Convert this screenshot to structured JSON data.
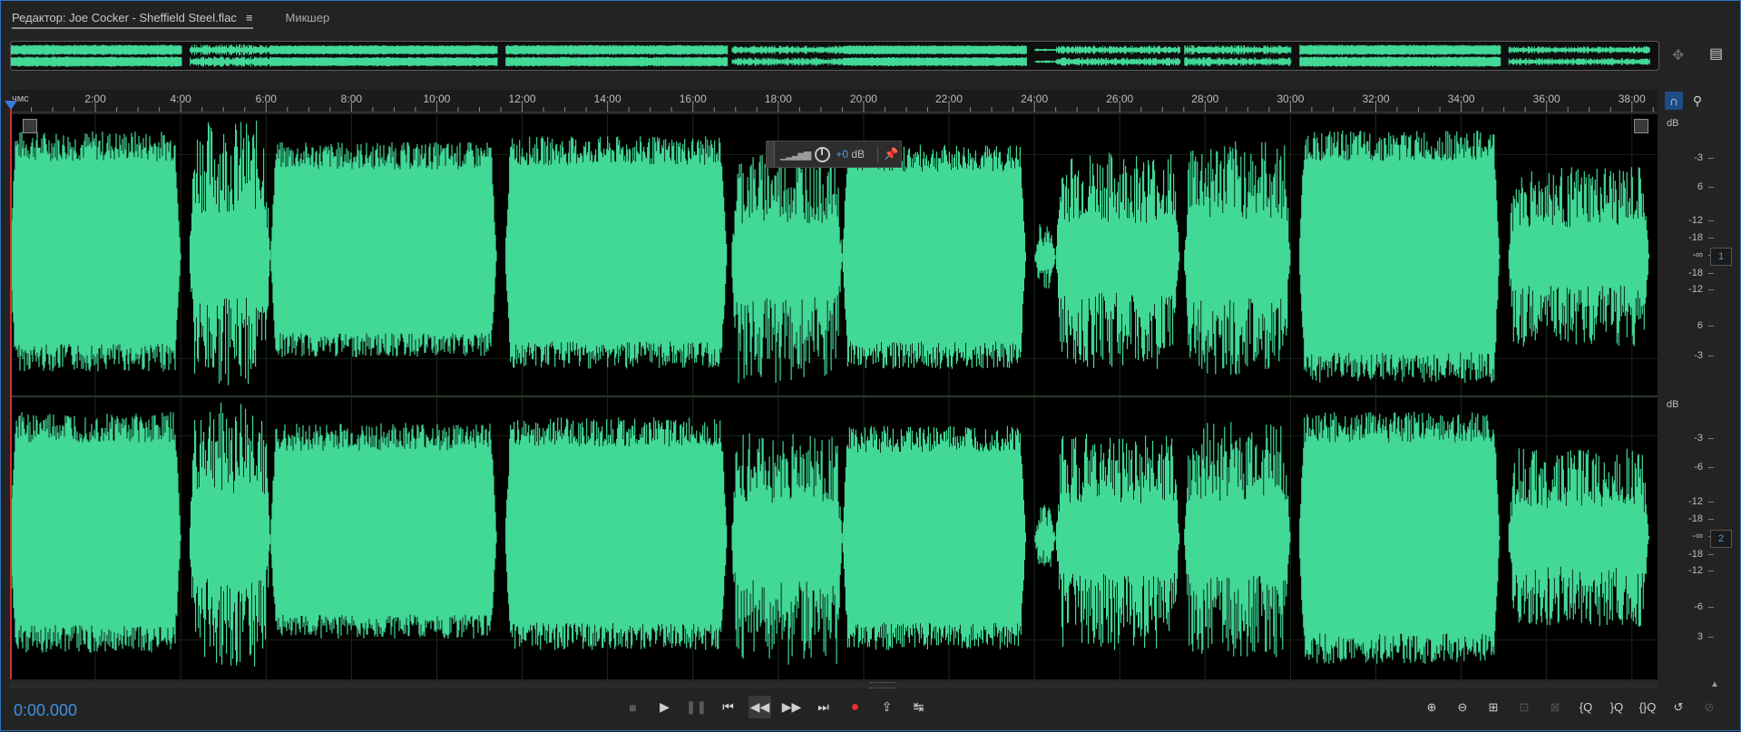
{
  "tabs": {
    "editor": "Редактор: Joe Cocker - Sheffield Steel.flac",
    "editor_menu": "≡",
    "mixer": "Микшер"
  },
  "ruler": {
    "unit": "чмс",
    "labels": [
      "2:00",
      "4:00",
      "6:00",
      "8:00",
      "10:00",
      "12:00",
      "14:00",
      "16:00",
      "18:00",
      "20:00",
      "22:00",
      "24:00",
      "26:00",
      "28:00",
      "30:00",
      "32:00",
      "34:00",
      "36:00",
      "38:00"
    ],
    "total_minutes": 38.6
  },
  "hud": {
    "value": "+0",
    "unit": " dB"
  },
  "db_scale": {
    "header": "dB",
    "channel1": [
      "-3",
      "6",
      "-12",
      "-18",
      "-∞",
      "-18",
      "-12",
      "6",
      "-3"
    ],
    "channel2": [
      "-3",
      "-6",
      "-12",
      "-18",
      "-∞",
      "-18",
      "-12",
      "-6",
      "3"
    ]
  },
  "channels": {
    "ch1": "1",
    "ch2": "2"
  },
  "timecode": "0:00.000",
  "colors": {
    "waveform": "#42d896",
    "accent": "#3f8fe0",
    "record": "#e52d2d",
    "playhead": "#d62e2e"
  },
  "transport": {
    "stop": "■",
    "play": "▶",
    "pause": "❚❚",
    "to_start": "⏮",
    "rewind": "◀◀",
    "forward": "▶▶",
    "to_end": "⏭",
    "record": "●",
    "loop": "⇪",
    "skip": "↹"
  },
  "zoom": {
    "zoom_in_amp": "⊕",
    "zoom_out_amp": "⊖",
    "zoom_full": "⊞",
    "zoom_sel": "⊡",
    "zoom_sel2": "⊠",
    "zoom_in_time": "{Q",
    "zoom_out_time": "}Q",
    "zoom_fit": "{}Q",
    "zoom_reset": "↺",
    "zoom_last": "⊘"
  },
  "waveform_segments": [
    {
      "s": 0.0,
      "e": 4.0,
      "top": 0.9,
      "bot": 0.82,
      "t": "dense"
    },
    {
      "s": 4.2,
      "e": 6.1,
      "top": 0.92,
      "bot": 0.86,
      "t": "spiky"
    },
    {
      "s": 6.1,
      "e": 11.4,
      "top": 0.82,
      "bot": 0.72,
      "t": "dense"
    },
    {
      "s": 11.6,
      "e": 16.8,
      "top": 0.86,
      "bot": 0.8,
      "t": "dense"
    },
    {
      "s": 16.9,
      "e": 19.5,
      "top": 0.7,
      "bot": 0.85,
      "t": "spiky"
    },
    {
      "s": 19.5,
      "e": 23.8,
      "top": 0.8,
      "bot": 0.8,
      "t": "dense"
    },
    {
      "s": 24.0,
      "e": 24.5,
      "top": 0.22,
      "bot": 0.22,
      "t": "spiky"
    },
    {
      "s": 24.5,
      "e": 27.4,
      "top": 0.7,
      "bot": 0.75,
      "t": "spiky"
    },
    {
      "s": 27.5,
      "e": 30.0,
      "top": 0.78,
      "bot": 0.8,
      "t": "spiky"
    },
    {
      "s": 30.2,
      "e": 34.9,
      "top": 0.9,
      "bot": 0.9,
      "t": "dense"
    },
    {
      "s": 35.1,
      "e": 38.4,
      "top": 0.6,
      "bot": 0.6,
      "t": "spiky"
    }
  ]
}
